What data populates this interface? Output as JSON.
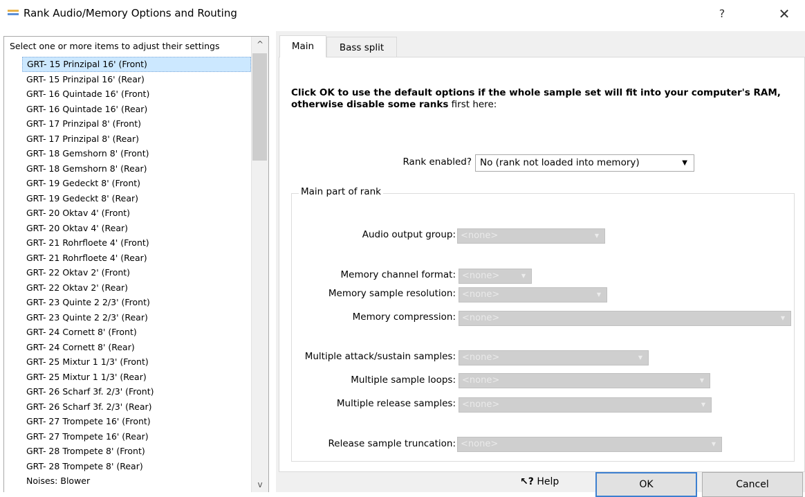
{
  "window": {
    "title": "Rank Audio/Memory Options and Routing",
    "help_glyph": "?",
    "close_glyph": "✕"
  },
  "list": {
    "header": "Select one or more items to adjust their settings",
    "items": [
      "GRT- 15 Prinzipal 16' (Front)",
      "GRT- 15 Prinzipal 16' (Rear)",
      "GRT- 16 Quintade 16' (Front)",
      "GRT- 16 Quintade 16' (Rear)",
      "GRT- 17 Prinzipal 8' (Front)",
      "GRT- 17 Prinzipal 8' (Rear)",
      "GRT- 18 Gemshorn 8' (Front)",
      "GRT- 18 Gemshorn 8' (Rear)",
      "GRT- 19 Gedeckt 8' (Front)",
      "GRT- 19 Gedeckt 8' (Rear)",
      "GRT- 20 Oktav 4' (Front)",
      "GRT- 20 Oktav 4' (Rear)",
      "GRT- 21 Rohrfloete 4' (Front)",
      "GRT- 21 Rohrfloete 4' (Rear)",
      "GRT- 22 Oktav 2' (Front)",
      "GRT- 22 Oktav 2' (Rear)",
      "GRT- 23 Quinte 2 2/3' (Front)",
      "GRT- 23 Quinte 2 2/3' (Rear)",
      "GRT- 24 Cornett 8' (Front)",
      "GRT- 24 Cornett 8' (Rear)",
      "GRT- 25 Mixtur 1 1/3' (Front)",
      "GRT- 25 Mixtur 1 1/3' (Rear)",
      "GRT- 26 Scharf 3f. 2/3' (Front)",
      "GRT- 26 Scharf 3f. 2/3' (Rear)",
      "GRT- 27 Trompete 16' (Front)",
      "GRT- 27 Trompete 16' (Rear)",
      "GRT- 28 Trompete 8' (Front)",
      "GRT- 28 Trompete 8' (Rear)",
      "Noises: Blower"
    ],
    "selected_index": 0,
    "scroll_up_glyph": "^",
    "scroll_down_glyph": "v"
  },
  "tabs": [
    "Main",
    "Bass split"
  ],
  "main": {
    "intro_bold": "Click OK to use the default options if the whole sample set will fit into your computer's RAM, otherwise disable some ranks",
    "intro_rest": " first here:",
    "rank_enabled_label": "Rank enabled?",
    "rank_enabled_value": "No (rank not loaded into memory)",
    "dropdown_glyph": "▼",
    "group_title": "Main part of rank",
    "fields": {
      "audio_output_group": {
        "label": "Audio output group:",
        "value": "<none>"
      },
      "memory_channel_format": {
        "label": "Memory channel format:",
        "value": "<none>"
      },
      "memory_sample_resolution": {
        "label": "Memory sample resolution:",
        "value": "<none>"
      },
      "memory_compression": {
        "label": "Memory compression:",
        "value": "<none>"
      },
      "multiple_attack_sustain": {
        "label": "Multiple attack/sustain samples:",
        "value": "<none>"
      },
      "multiple_sample_loops": {
        "label": "Multiple sample loops:",
        "value": "<none>"
      },
      "multiple_release_samples": {
        "label": "Multiple release samples:",
        "value": "<none>"
      },
      "release_sample_truncation": {
        "label": "Release sample truncation:",
        "value": "<none>"
      }
    }
  },
  "footer": {
    "help_icon": "↖?",
    "help_label": "Help",
    "ok_label": "OK",
    "cancel_label": "Cancel"
  },
  "colors": {
    "selection": "#cce8ff",
    "ok_border": "#3c7fd0",
    "disabled_combo": "#cfcfcf"
  }
}
